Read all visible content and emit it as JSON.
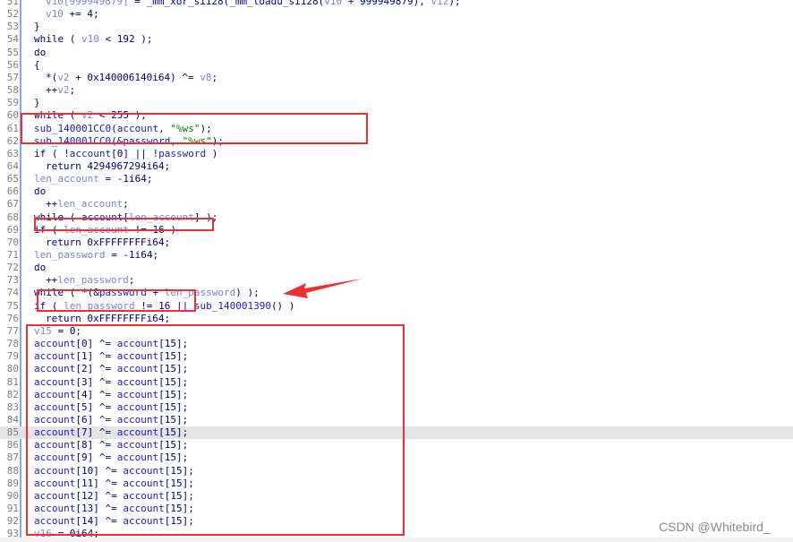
{
  "colors": {
    "annotation": "#f03030",
    "keyword": "#000080",
    "local_var": "#8080e0",
    "global": "#1a1ad0",
    "string": "#008000",
    "line_number": "#808080",
    "highlight": "#e4e4e4"
  },
  "highlighted_line": 85,
  "lines": [
    {
      "n": "51",
      "indent": 1,
      "t": [
        [
          "v10[999949879]",
          "var"
        ],
        [
          " = _mm_xor_si128(_mm_loadu_si128(",
          "plain"
        ],
        [
          "v10",
          "var"
        ],
        [
          " + 999949879), ",
          "plain"
        ],
        [
          "v12",
          "var"
        ],
        [
          ");",
          "plain"
        ]
      ]
    },
    {
      "n": "52",
      "indent": 1,
      "t": [
        [
          "v10",
          "var"
        ],
        [
          " += 4;",
          "plain"
        ]
      ]
    },
    {
      "n": "53",
      "indent": 0,
      "t": [
        [
          "}",
          "plain"
        ]
      ]
    },
    {
      "n": "54",
      "indent": 0,
      "t": [
        [
          "while ( ",
          "kw"
        ],
        [
          "v10",
          "var"
        ],
        [
          " < 192 );",
          "plain"
        ]
      ]
    },
    {
      "n": "55",
      "indent": 0,
      "t": [
        [
          "do",
          "kw"
        ]
      ]
    },
    {
      "n": "56",
      "indent": 0,
      "t": [
        [
          "{",
          "plain"
        ]
      ]
    },
    {
      "n": "57",
      "indent": 1,
      "t": [
        [
          "*(",
          "plain"
        ],
        [
          "v2",
          "var"
        ],
        [
          " + 0x140006140i64) ^= ",
          "plain"
        ],
        [
          "v8",
          "var"
        ],
        [
          ";",
          "plain"
        ]
      ]
    },
    {
      "n": "58",
      "indent": 1,
      "t": [
        [
          "++",
          "plain"
        ],
        [
          "v2",
          "var"
        ],
        [
          ";",
          "plain"
        ]
      ]
    },
    {
      "n": "59",
      "indent": 0,
      "t": [
        [
          "}",
          "plain"
        ]
      ]
    },
    {
      "n": "60",
      "indent": 0,
      "t": [
        [
          "while ( ",
          "kw"
        ],
        [
          "v2",
          "var"
        ],
        [
          " < 255 );",
          "plain"
        ]
      ]
    },
    {
      "n": "61",
      "indent": 0,
      "t": [
        [
          "sub_140001CC0",
          "fn"
        ],
        [
          "(",
          "plain"
        ],
        [
          "account",
          "glob"
        ],
        [
          ", ",
          "plain"
        ],
        [
          "\"%ws\"",
          "str"
        ],
        [
          ");",
          "plain"
        ]
      ]
    },
    {
      "n": "62",
      "indent": 0,
      "t": [
        [
          "sub_140001CC0",
          "fn"
        ],
        [
          "(&",
          "plain"
        ],
        [
          "password",
          "glob"
        ],
        [
          ", ",
          "plain"
        ],
        [
          "\"%ws\"",
          "str"
        ],
        [
          ");",
          "plain"
        ]
      ]
    },
    {
      "n": "63",
      "indent": 0,
      "t": [
        [
          "if ( !",
          "kw"
        ],
        [
          "account",
          "glob"
        ],
        [
          "[0] || !",
          "plain"
        ],
        [
          "password",
          "glob"
        ],
        [
          " )",
          "plain"
        ]
      ]
    },
    {
      "n": "64",
      "indent": 1,
      "t": [
        [
          "return 4294967294i64;",
          "kw"
        ]
      ]
    },
    {
      "n": "65",
      "indent": 0,
      "t": [
        [
          "len_account",
          "var"
        ],
        [
          " = -1i64;",
          "plain"
        ]
      ]
    },
    {
      "n": "66",
      "indent": 0,
      "t": [
        [
          "do",
          "kw"
        ]
      ]
    },
    {
      "n": "67",
      "indent": 1,
      "t": [
        [
          "++",
          "plain"
        ],
        [
          "len_account",
          "var"
        ],
        [
          ";",
          "plain"
        ]
      ]
    },
    {
      "n": "68",
      "indent": 0,
      "t": [
        [
          "while ( ",
          "kw"
        ],
        [
          "account",
          "glob"
        ],
        [
          "[",
          "plain"
        ],
        [
          "len_account",
          "var"
        ],
        [
          "] );",
          "plain"
        ]
      ]
    },
    {
      "n": "69",
      "indent": 0,
      "t": [
        [
          "if ( ",
          "kw"
        ],
        [
          "len_account",
          "var"
        ],
        [
          " != 16 )",
          "plain"
        ]
      ]
    },
    {
      "n": "70",
      "indent": 1,
      "t": [
        [
          "return 0xFFFFFFFFi64;",
          "kw"
        ]
      ]
    },
    {
      "n": "71",
      "indent": 0,
      "t": [
        [
          "len_password",
          "var"
        ],
        [
          " = -1i64;",
          "plain"
        ]
      ]
    },
    {
      "n": "72",
      "indent": 0,
      "t": [
        [
          "do",
          "kw"
        ]
      ]
    },
    {
      "n": "73",
      "indent": 1,
      "t": [
        [
          "++",
          "plain"
        ],
        [
          "len_password",
          "var"
        ],
        [
          ";",
          "plain"
        ]
      ]
    },
    {
      "n": "74",
      "indent": 0,
      "t": [
        [
          "while ( *(&",
          "kw"
        ],
        [
          "password",
          "glob"
        ],
        [
          " + ",
          "plain"
        ],
        [
          "len_password",
          "var"
        ],
        [
          ") );",
          "plain"
        ]
      ]
    },
    {
      "n": "75",
      "indent": 0,
      "t": [
        [
          "if ( ",
          "kw"
        ],
        [
          "len_password",
          "var"
        ],
        [
          " != 16 || ",
          "plain"
        ],
        [
          "sub_140001390",
          "fn"
        ],
        [
          "() )",
          "plain"
        ]
      ]
    },
    {
      "n": "76",
      "indent": 1,
      "t": [
        [
          "return 0xFFFFFFFFi64;",
          "kw"
        ]
      ]
    },
    {
      "n": "77",
      "indent": 0,
      "t": [
        [
          "v15",
          "var"
        ],
        [
          " = 0;",
          "plain"
        ]
      ]
    },
    {
      "n": "78",
      "indent": 0,
      "t": [
        [
          "account",
          "glob"
        ],
        [
          "[0] ^= ",
          "plain"
        ],
        [
          "account",
          "glob"
        ],
        [
          "[15];",
          "plain"
        ]
      ]
    },
    {
      "n": "79",
      "indent": 0,
      "t": [
        [
          "account",
          "glob"
        ],
        [
          "[1] ^= ",
          "plain"
        ],
        [
          "account",
          "glob"
        ],
        [
          "[15];",
          "plain"
        ]
      ]
    },
    {
      "n": "80",
      "indent": 0,
      "t": [
        [
          "account",
          "glob"
        ],
        [
          "[2] ^= ",
          "plain"
        ],
        [
          "account",
          "glob"
        ],
        [
          "[15];",
          "plain"
        ]
      ]
    },
    {
      "n": "81",
      "indent": 0,
      "t": [
        [
          "account",
          "glob"
        ],
        [
          "[3] ^= ",
          "plain"
        ],
        [
          "account",
          "glob"
        ],
        [
          "[15];",
          "plain"
        ]
      ]
    },
    {
      "n": "82",
      "indent": 0,
      "t": [
        [
          "account",
          "glob"
        ],
        [
          "[4] ^= ",
          "plain"
        ],
        [
          "account",
          "glob"
        ],
        [
          "[15];",
          "plain"
        ]
      ]
    },
    {
      "n": "83",
      "indent": 0,
      "t": [
        [
          "account",
          "glob"
        ],
        [
          "[5] ^= ",
          "plain"
        ],
        [
          "account",
          "glob"
        ],
        [
          "[15];",
          "plain"
        ]
      ]
    },
    {
      "n": "84",
      "indent": 0,
      "t": [
        [
          "account",
          "glob"
        ],
        [
          "[6] ^= ",
          "plain"
        ],
        [
          "account",
          "glob"
        ],
        [
          "[15];",
          "plain"
        ]
      ]
    },
    {
      "n": "85",
      "indent": 0,
      "t": [
        [
          "account",
          "glob"
        ],
        [
          "[7] ^= ",
          "plain"
        ],
        [
          "account",
          "glob"
        ],
        [
          "[15];",
          "plain"
        ]
      ]
    },
    {
      "n": "86",
      "indent": 0,
      "t": [
        [
          "account",
          "glob"
        ],
        [
          "[8] ^= ",
          "plain"
        ],
        [
          "account",
          "glob"
        ],
        [
          "[15];",
          "plain"
        ]
      ]
    },
    {
      "n": "87",
      "indent": 0,
      "t": [
        [
          "account",
          "glob"
        ],
        [
          "[9] ^= ",
          "plain"
        ],
        [
          "account",
          "glob"
        ],
        [
          "[15];",
          "plain"
        ]
      ]
    },
    {
      "n": "88",
      "indent": 0,
      "t": [
        [
          "account",
          "glob"
        ],
        [
          "[10] ^= ",
          "plain"
        ],
        [
          "account",
          "glob"
        ],
        [
          "[15];",
          "plain"
        ]
      ]
    },
    {
      "n": "89",
      "indent": 0,
      "t": [
        [
          "account",
          "glob"
        ],
        [
          "[11] ^= ",
          "plain"
        ],
        [
          "account",
          "glob"
        ],
        [
          "[15];",
          "plain"
        ]
      ]
    },
    {
      "n": "90",
      "indent": 0,
      "t": [
        [
          "account",
          "glob"
        ],
        [
          "[12] ^= ",
          "plain"
        ],
        [
          "account",
          "glob"
        ],
        [
          "[15];",
          "plain"
        ]
      ]
    },
    {
      "n": "91",
      "indent": 0,
      "t": [
        [
          "account",
          "glob"
        ],
        [
          "[13] ^= ",
          "plain"
        ],
        [
          "account",
          "glob"
        ],
        [
          "[15];",
          "plain"
        ]
      ]
    },
    {
      "n": "92",
      "indent": 0,
      "t": [
        [
          "account",
          "glob"
        ],
        [
          "[14] ^= ",
          "plain"
        ],
        [
          "account",
          "glob"
        ],
        [
          "[15];",
          "plain"
        ]
      ]
    },
    {
      "n": "93",
      "indent": 0,
      "t": [
        [
          "v16",
          "var"
        ],
        [
          " = 0i64;",
          "plain"
        ]
      ]
    }
  ],
  "watermark": "CSDN @Whitebird_"
}
